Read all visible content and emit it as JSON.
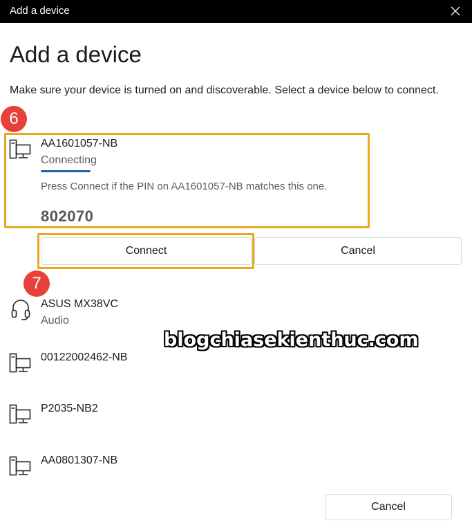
{
  "window": {
    "title": "Add a device",
    "close_icon": "close-icon"
  },
  "heading": "Add a device",
  "instructions": "Make sure your device is turned on and discoverable. Select a device below to connect.",
  "selected_device": {
    "name": "AA1601057-NB",
    "status": "Connecting",
    "icon": "computer-icon",
    "pin_message": "Press Connect if the PIN on AA1601057-NB matches this one.",
    "pin": "802070",
    "connect_label": "Connect",
    "cancel_label": "Cancel"
  },
  "devices": [
    {
      "name": "ASUS MX38VC",
      "subtitle": "Audio",
      "icon": "headset-icon"
    },
    {
      "name": "00122002462-NB",
      "subtitle": "",
      "icon": "computer-icon"
    },
    {
      "name": "P2035-NB2",
      "subtitle": "",
      "icon": "computer-icon"
    },
    {
      "name": "AA0801307-NB",
      "subtitle": "",
      "icon": "computer-icon"
    }
  ],
  "footer": {
    "cancel_label": "Cancel"
  },
  "annotations": {
    "step_6": "6",
    "step_7": "7"
  },
  "watermark": "blogchiasekienthuc.com",
  "colors": {
    "titlebar": "#000000",
    "highlight": "#e8a81c",
    "badge": "#e8413c",
    "progress": "#1f5fa8"
  }
}
